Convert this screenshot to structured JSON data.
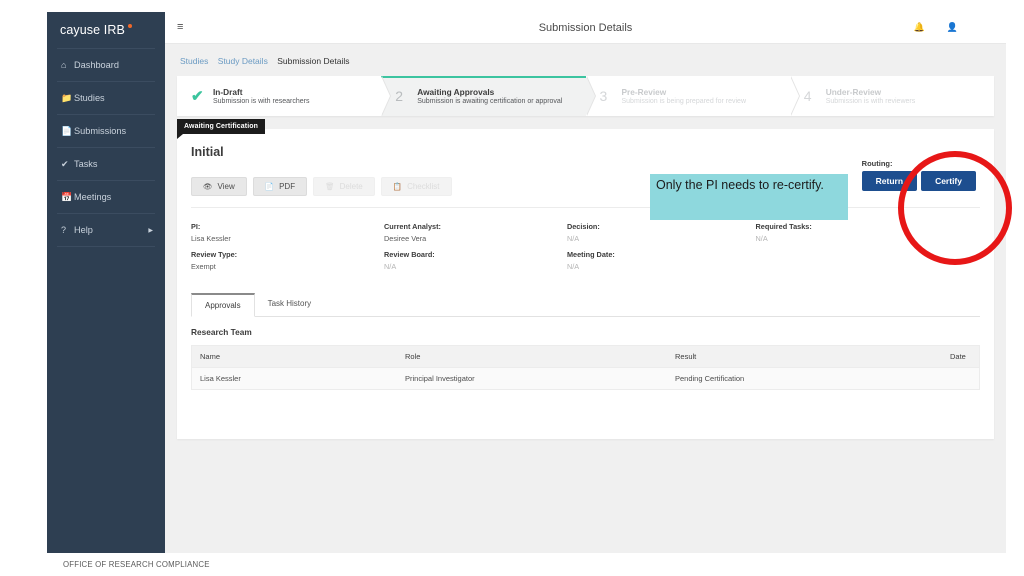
{
  "sidebar": {
    "brand": "cayuse IRB",
    "brand_dot_color": "#f0682a",
    "bg_color": "#2e3f52",
    "items": [
      {
        "label": "Dashboard",
        "icon": "dashboard-icon",
        "glyph": "⌂",
        "caret": ""
      },
      {
        "label": "Studies",
        "icon": "folder-icon",
        "glyph": "📁",
        "caret": ""
      },
      {
        "label": "Submissions",
        "icon": "document-icon",
        "glyph": "📄",
        "caret": ""
      },
      {
        "label": "Tasks",
        "icon": "check-icon",
        "glyph": "✔",
        "caret": ""
      },
      {
        "label": "Meetings",
        "icon": "calendar-icon",
        "glyph": "📅",
        "caret": ""
      },
      {
        "label": "Help",
        "icon": "question-icon",
        "glyph": "?",
        "caret": "▶"
      }
    ]
  },
  "topbar": {
    "menu_icon": "hamburger-icon",
    "menu_glyph": "≡",
    "title": "Submission Details",
    "notifications_icon": "bell-icon",
    "notifications_glyph": "🔔",
    "account_icon": "user-icon",
    "account_glyph": "👤"
  },
  "breadcrumb": {
    "items": [
      "Studies",
      "Study Details"
    ],
    "current": "Submission Details"
  },
  "stepper": {
    "steps": [
      {
        "mark": "✔",
        "is_check": true,
        "state": "complete",
        "title": "In-Draft",
        "subtitle": "Submission is with researchers"
      },
      {
        "mark": "2",
        "is_check": false,
        "state": "active",
        "title": "Awaiting Approvals",
        "subtitle": "Submission is awaiting certification or approval"
      },
      {
        "mark": "3",
        "is_check": false,
        "state": "dim",
        "title": "Pre-Review",
        "subtitle": "Submission is being prepared for review"
      },
      {
        "mark": "4",
        "is_check": false,
        "state": "dim",
        "title": "Under-Review",
        "subtitle": "Submission is with reviewers"
      }
    ]
  },
  "card": {
    "status_badge": "Awaiting Certification",
    "title": "Initial",
    "subtitle": "",
    "buttons": [
      {
        "label": "View",
        "icon": "eye-icon",
        "glyph": "👁",
        "disabled": false
      },
      {
        "label": "PDF",
        "icon": "pdf-icon",
        "glyph": "📄",
        "disabled": false
      },
      {
        "label": "Delete",
        "icon": "trash-icon",
        "glyph": "🗑",
        "disabled": true
      },
      {
        "label": "Checklist",
        "icon": "clipboard-icon",
        "glyph": "📋",
        "disabled": true
      }
    ],
    "routing": {
      "label": "Routing:",
      "button_color": "#1d4e8f",
      "buttons": [
        "Return",
        "Certify"
      ]
    },
    "meta": [
      {
        "key": "PI:",
        "value": "Lisa Kessler",
        "na": false
      },
      {
        "key": "Current Analyst:",
        "value": "Desiree Vera",
        "na": false
      },
      {
        "key": "Decision:",
        "value": "N/A",
        "na": true
      },
      {
        "key": "Required Tasks:",
        "value": "N/A",
        "na": true
      },
      {
        "key": "Review Type:",
        "value": "Exempt",
        "na": false
      },
      {
        "key": "Review Board:",
        "value": "N/A",
        "na": true
      },
      {
        "key": "Meeting Date:",
        "value": "N/A",
        "na": true
      },
      {
        "key": "",
        "value": "",
        "na": false
      }
    ],
    "tabs": [
      {
        "label": "Approvals",
        "selected": true
      },
      {
        "label": "Task History",
        "selected": false
      }
    ],
    "section_title": "Research Team",
    "table": {
      "columns": [
        "Name",
        "Role",
        "Result",
        "Date"
      ],
      "rows": [
        [
          "Lisa Kessler",
          "Principal Investigator",
          "Pending Certification",
          ""
        ]
      ]
    }
  },
  "annotations": {
    "callout_text": "Only the PI needs to re-certify.",
    "callout_bg": "#8ed8dd",
    "highlight_circle_color": "#e71717"
  },
  "footer": {
    "text": "OFFICE OF RESEARCH COMPLIANCE"
  }
}
